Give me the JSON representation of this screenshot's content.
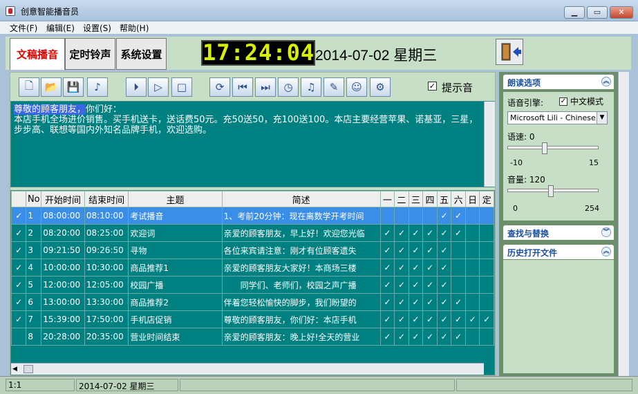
{
  "window": {
    "title": "创意智能播音员",
    "min": "▁",
    "max": "▭",
    "close": "✕"
  },
  "menu": [
    "文件(F)",
    "编辑(E)",
    "设置(S)",
    "帮助(H)"
  ],
  "tabs": [
    "文稿播音",
    "定时铃声",
    "系统设置"
  ],
  "clock": "17:24:04",
  "date_display": "2014-07-02 星期三",
  "toolbar": {
    "hint_checked": "✓",
    "hint_label": "提示音"
  },
  "editor": {
    "selected": "尊敬的顾客朋友，",
    "rest": "你们好：\n本店手机全场进价销售。买手机送卡，送话费50元。充50送50，充100送100。本店主要经营苹果、诺基亚，三星，步步高、联想等国内外知名品牌手机，欢迎选购。"
  },
  "table": {
    "headers": [
      "",
      "No",
      "开始时间",
      "结束时间",
      "主题",
      "简述",
      "一",
      "二",
      "三",
      "四",
      "五",
      "六",
      "日",
      "定"
    ],
    "rows": [
      {
        "check": "✓",
        "no": "1",
        "start": "08:00:00",
        "end": "08:10:00",
        "topic": "考试播音",
        "desc": "1、考前20分钟：现在离数学开考时间",
        "days": [
          "",
          "",
          "",
          "",
          "✓",
          "✓",
          "",
          ""
        ]
      },
      {
        "check": "✓",
        "no": "2",
        "start": "08:20:00",
        "end": "08:25:00",
        "topic": "欢迎词",
        "desc": "亲爱的顾客朋友，早上好！欢迎您光临",
        "days": [
          "✓",
          "✓",
          "✓",
          "✓",
          "✓",
          "✓",
          "",
          ""
        ]
      },
      {
        "check": "✓",
        "no": "3",
        "start": "09:21:50",
        "end": "09:26:50",
        "topic": "寻物",
        "desc": "各位来宾请注意：刚才有位顾客遗失",
        "days": [
          "✓",
          "✓",
          "✓",
          "✓",
          "✓",
          "",
          "",
          ""
        ]
      },
      {
        "check": "✓",
        "no": "4",
        "start": "10:00:00",
        "end": "10:30:00",
        "topic": "商品推荐1",
        "desc": "亲爱的顾客朋友大家好！本商场三楼",
        "days": [
          "✓",
          "✓",
          "✓",
          "✓",
          "✓",
          "",
          "",
          ""
        ]
      },
      {
        "check": "✓",
        "no": "5",
        "start": "12:00:00",
        "end": "12:05:00",
        "topic": "校园广播",
        "desc": "　　同学们、老师们，校园之声广播",
        "days": [
          "✓",
          "✓",
          "✓",
          "✓",
          "✓",
          "",
          "",
          ""
        ]
      },
      {
        "check": "✓",
        "no": "6",
        "start": "13:00:00",
        "end": "13:30:00",
        "topic": "商品推荐2",
        "desc": "伴着您轻松愉快的脚步，我们盼望的",
        "days": [
          "✓",
          "✓",
          "✓",
          "✓",
          "✓",
          "✓",
          "",
          ""
        ]
      },
      {
        "check": "✓",
        "no": "7",
        "start": "15:39:00",
        "end": "17:50:00",
        "topic": "手机店促销",
        "desc": "尊敬的顾客朋友，你们好：本店手机",
        "days": [
          "✓",
          "✓",
          "✓",
          "✓",
          "✓",
          "✓",
          "✓",
          "✓"
        ]
      },
      {
        "check": "",
        "no": "8",
        "start": "20:28:00",
        "end": "20:35:00",
        "topic": "营业时间结束",
        "desc": "亲爱的顾客朋友：晚上好!全天的营业",
        "days": [
          "✓",
          "✓",
          "✓",
          "✓",
          "✓",
          "✓",
          "",
          ""
        ]
      }
    ]
  },
  "right": {
    "read_title": "朗读选项",
    "engine_label": "语音引擎:",
    "cn_mode_checked": "✓",
    "cn_mode_label": "中文模式",
    "engine_value": "Microsoft Lili - Chinese (C",
    "speed_label": "语速:  0",
    "speed_min": "-10",
    "speed_max": "15",
    "speed_value": 0,
    "volume_label": "音量:  120",
    "volume_min": "0",
    "volume_max": "254",
    "volume_value": 120,
    "find_title": "查找与替换",
    "history_title": "历史打开文件"
  },
  "status": {
    "pos": "1:1",
    "date": "2014-07-02 星期三"
  }
}
